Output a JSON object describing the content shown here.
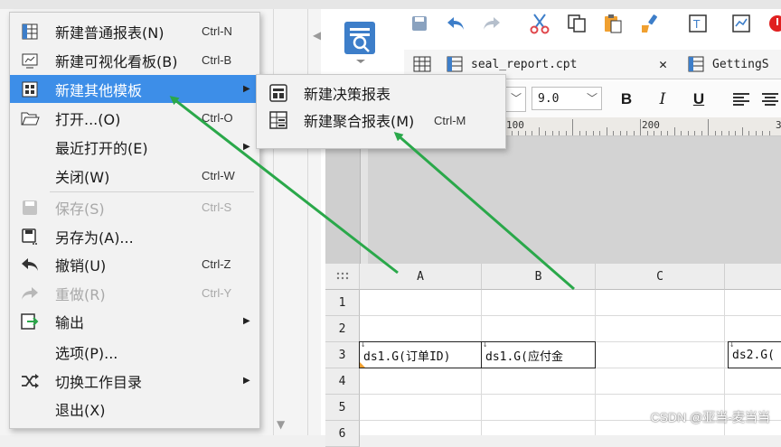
{
  "colors": {
    "highlight": "#3d8ee8",
    "arrow": "#2aa84a",
    "accent_orange": "#f0a030",
    "icon_blue": "#3d7ec9"
  },
  "main_menu": {
    "items": [
      {
        "label": "新建普通报表(N)",
        "shortcut": "Ctrl-N",
        "icon": "grid-report-icon",
        "enabled": true,
        "submenu": false
      },
      {
        "label": "新建可视化看板(B)",
        "shortcut": "Ctrl-B",
        "icon": "dashboard-icon",
        "enabled": true,
        "submenu": false
      },
      {
        "label": "新建其他模板",
        "shortcut": "",
        "icon": "template-icon",
        "enabled": true,
        "submenu": true,
        "highlighted": true
      },
      {
        "label": "打开...(O)",
        "shortcut": "Ctrl-O",
        "icon": "folder-open-icon",
        "enabled": true,
        "submenu": false
      },
      {
        "label": "最近打开的(E)",
        "shortcut": "",
        "icon": "",
        "enabled": true,
        "submenu": true
      },
      {
        "label": "关闭(W)",
        "shortcut": "Ctrl-W",
        "icon": "",
        "enabled": true,
        "submenu": false
      },
      {
        "label": "保存(S)",
        "shortcut": "Ctrl-S",
        "icon": "save-icon",
        "enabled": false,
        "submenu": false
      },
      {
        "label": "另存为(A)...",
        "shortcut": "",
        "icon": "save-as-icon",
        "enabled": true,
        "submenu": false
      },
      {
        "label": "撤销(U)",
        "shortcut": "Ctrl-Z",
        "icon": "undo-icon",
        "enabled": true,
        "submenu": false
      },
      {
        "label": "重做(R)",
        "shortcut": "Ctrl-Y",
        "icon": "redo-icon",
        "enabled": false,
        "submenu": false
      },
      {
        "label": "输出",
        "shortcut": "",
        "icon": "export-icon",
        "enabled": true,
        "submenu": true
      },
      {
        "label": "选项(P)...",
        "shortcut": "",
        "icon": "",
        "enabled": true,
        "submenu": false
      },
      {
        "label": "切换工作目录",
        "shortcut": "",
        "icon": "shuffle-icon",
        "enabled": true,
        "submenu": true
      },
      {
        "label": "退出(X)",
        "shortcut": "",
        "icon": "",
        "enabled": true,
        "submenu": false
      }
    ]
  },
  "sub_menu": {
    "items": [
      {
        "label": "新建决策报表",
        "shortcut": "",
        "icon": "decision-report-icon"
      },
      {
        "label": "新建聚合报表(M)",
        "shortcut": "Ctrl-M",
        "icon": "aggregate-report-icon"
      }
    ]
  },
  "file_tabs": [
    {
      "label": "seal_report.cpt"
    },
    {
      "label": "GettingS"
    }
  ],
  "format_bar": {
    "font_size": "9.0",
    "bold": "B",
    "italic": "I",
    "underline": "U"
  },
  "ruler": {
    "labels": [
      "100",
      "200",
      "3"
    ]
  },
  "sheet": {
    "columns": [
      "A",
      "B",
      "C"
    ],
    "rows": [
      "1",
      "2",
      "3",
      "4",
      "5",
      "6"
    ],
    "cells": [
      {
        "ref": "A3",
        "text": "ds1.G(订单ID)"
      },
      {
        "ref": "B3",
        "text": "ds1.G(应付金"
      },
      {
        "ref": "D3",
        "text": "ds2.G("
      }
    ]
  },
  "watermark": "CSDN @亚当-麦当当"
}
